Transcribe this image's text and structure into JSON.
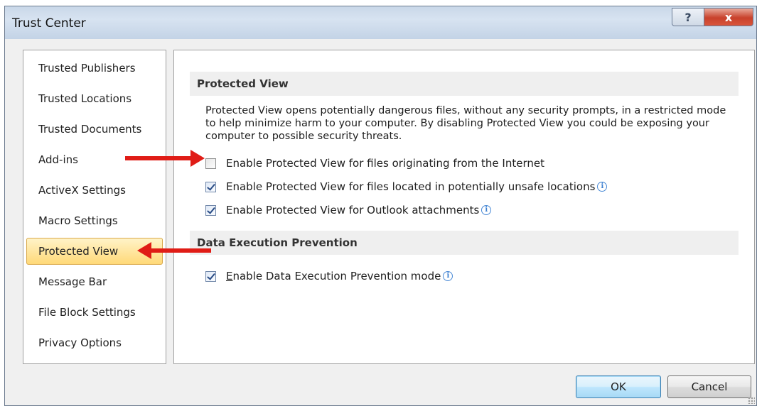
{
  "window": {
    "title": "Trust Center",
    "help_label": "?",
    "close_label": "x"
  },
  "nav": {
    "items": [
      {
        "label": "Trusted Publishers"
      },
      {
        "label": "Trusted Locations"
      },
      {
        "label": "Trusted Documents"
      },
      {
        "label": "Add-ins"
      },
      {
        "label": "ActiveX Settings"
      },
      {
        "label": "Macro Settings"
      },
      {
        "label": "Protected View",
        "selected": true
      },
      {
        "label": "Message Bar"
      },
      {
        "label": "File Block Settings"
      },
      {
        "label": "Privacy Options"
      }
    ]
  },
  "protected_view": {
    "header": "Protected View",
    "description": "Protected View opens potentially dangerous files, without any security prompts, in a restricted mode to help minimize harm to your computer. By disabling Protected View you could be exposing your computer to possible security threats.",
    "options": [
      {
        "label": "Enable Protected View for files originating from the Internet",
        "checked": false,
        "info": false
      },
      {
        "label": "Enable Protected View for files located in potentially unsafe locations",
        "checked": true,
        "info": true
      },
      {
        "label": "Enable Protected View for Outlook attachments",
        "checked": true,
        "info": true
      }
    ]
  },
  "dep": {
    "header": "Data Execution Prevention",
    "option": {
      "label": "Enable Data Execution Prevention mode",
      "checked": true,
      "info": true
    }
  },
  "buttons": {
    "ok": "OK",
    "cancel": "Cancel"
  },
  "info_glyph": "i",
  "colors": {
    "annotation_arrow": "#e01c16",
    "selected_item": "#ffd978",
    "section_header_bg": "#efefef"
  }
}
